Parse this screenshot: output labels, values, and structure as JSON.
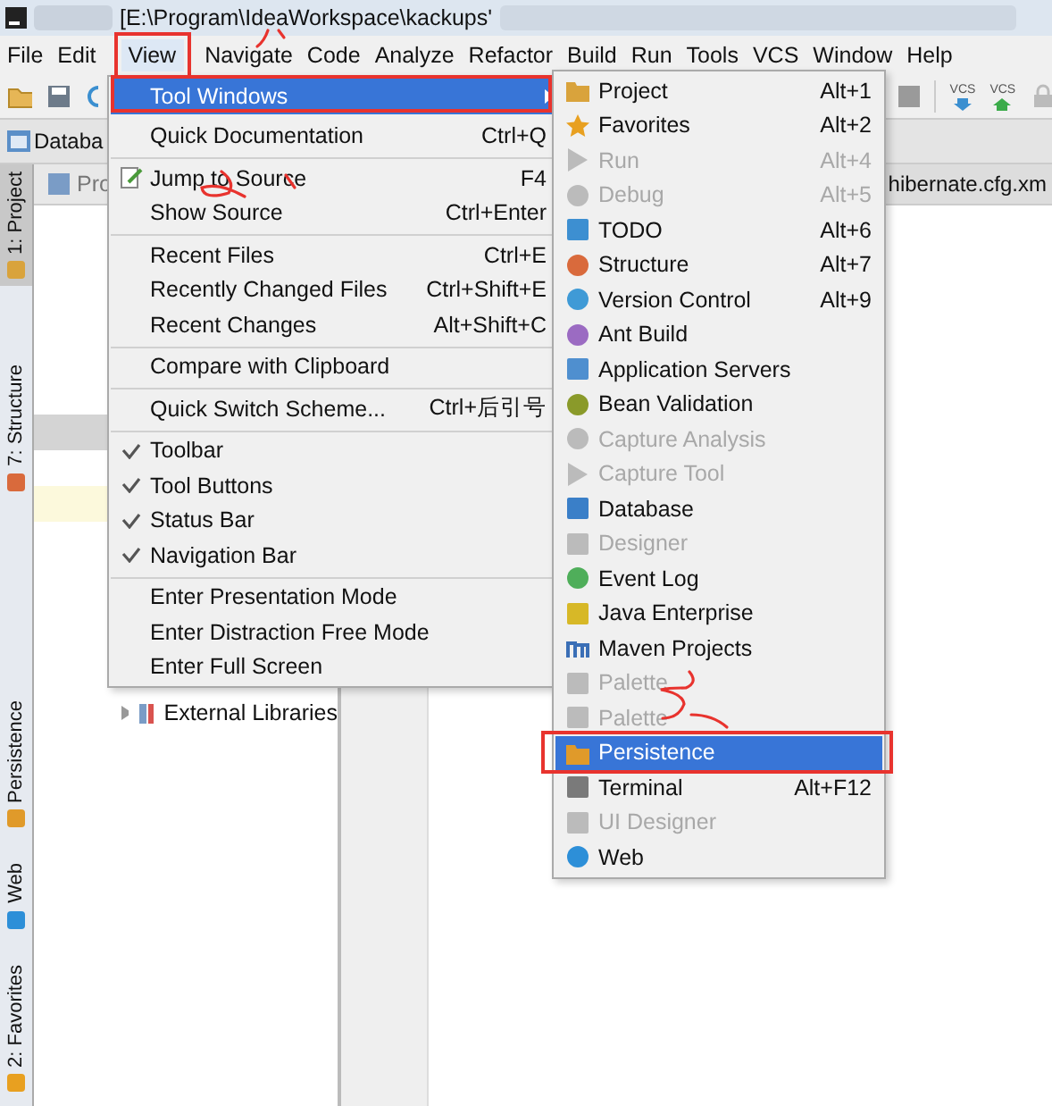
{
  "window": {
    "title": "[E:\\Program\\IdeaWorkspace\\kackups'"
  },
  "menubar": [
    {
      "label": "File",
      "selected": false
    },
    {
      "label": "Edit",
      "selected": false
    },
    {
      "label": "View",
      "selected": true
    },
    {
      "label": "Navigate",
      "selected": false
    },
    {
      "label": "Code",
      "selected": false
    },
    {
      "label": "Analyze",
      "selected": false
    },
    {
      "label": "Refactor",
      "selected": false
    },
    {
      "label": "Build",
      "selected": false
    },
    {
      "label": "Run",
      "selected": false
    },
    {
      "label": "Tools",
      "selected": false
    },
    {
      "label": "VCS",
      "selected": false
    },
    {
      "label": "Window",
      "selected": false
    },
    {
      "label": "Help",
      "selected": false
    }
  ],
  "toolbar": {
    "vcs_labels": [
      "VCS",
      "VCS"
    ]
  },
  "navigation_bar": {
    "label": "Databa"
  },
  "project_panel": {
    "tab": "Pro",
    "rows": [
      {
        "label": "External Libraries"
      }
    ]
  },
  "editor_tabs": [
    {
      "label": "hibernate.cfg.xm"
    }
  ],
  "left_stripe": {
    "top": [
      {
        "label": "1: Project",
        "selected": true,
        "kind": "project"
      },
      {
        "label": "7: Structure",
        "selected": false,
        "kind": "structure"
      }
    ],
    "bottom": [
      {
        "label": "Persistence",
        "selected": false,
        "kind": "persistence"
      },
      {
        "label": "Web",
        "selected": false,
        "kind": "web"
      },
      {
        "label": "2: Favorites",
        "selected": false,
        "kind": "favorites"
      }
    ]
  },
  "view_menu": {
    "items": [
      {
        "kind": "submenu",
        "label": "Tool Windows",
        "selected": true,
        "checked": false
      },
      {
        "kind": "item",
        "label": "Quick Documentation",
        "shortcut": "Ctrl+Q",
        "selected": false,
        "checked": false
      },
      {
        "kind": "separator"
      },
      {
        "kind": "item",
        "label": "Jump to Source",
        "shortcut": "F4",
        "selected": false,
        "checked": false,
        "icon": true
      },
      {
        "kind": "item",
        "label": "Show Source",
        "shortcut": "Ctrl+Enter",
        "selected": false,
        "checked": false
      },
      {
        "kind": "separator"
      },
      {
        "kind": "item",
        "label": "Recent Files",
        "shortcut": "Ctrl+E",
        "selected": false,
        "checked": false
      },
      {
        "kind": "item",
        "label": "Recently Changed Files",
        "shortcut": "Ctrl+Shift+E",
        "selected": false,
        "checked": false
      },
      {
        "kind": "item",
        "label": "Recent Changes",
        "shortcut": "Alt+Shift+C",
        "selected": false,
        "checked": false
      },
      {
        "kind": "separator"
      },
      {
        "kind": "item",
        "label": "Compare with Clipboard",
        "selected": false,
        "checked": false
      },
      {
        "kind": "separator"
      },
      {
        "kind": "item",
        "label": "Quick Switch Scheme...",
        "shortcut": "Ctrl+后引号",
        "selected": false,
        "checked": false
      },
      {
        "kind": "separator"
      },
      {
        "kind": "item",
        "label": "Toolbar",
        "selected": false,
        "checked": true
      },
      {
        "kind": "item",
        "label": "Tool Buttons",
        "selected": false,
        "checked": true
      },
      {
        "kind": "item",
        "label": "Status Bar",
        "selected": false,
        "checked": true
      },
      {
        "kind": "item",
        "label": "Navigation Bar",
        "selected": false,
        "checked": true
      },
      {
        "kind": "separator"
      },
      {
        "kind": "item",
        "label": "Enter Presentation Mode",
        "selected": false,
        "checked": false
      },
      {
        "kind": "item",
        "label": "Enter Distraction Free Mode",
        "selected": false,
        "checked": false
      },
      {
        "kind": "item",
        "label": "Enter Full Screen",
        "selected": false,
        "checked": false
      }
    ]
  },
  "tool_windows_menu": {
    "items": [
      {
        "kind": "project",
        "label": "Project",
        "shortcut": "Alt+1",
        "disabled": false,
        "selected": false
      },
      {
        "kind": "favorites",
        "label": "Favorites",
        "shortcut": "Alt+2",
        "disabled": false,
        "selected": false
      },
      {
        "kind": "run",
        "label": "Run",
        "shortcut": "Alt+4",
        "disabled": true,
        "selected": false
      },
      {
        "kind": "debug",
        "label": "Debug",
        "shortcut": "Alt+5",
        "disabled": true,
        "selected": false
      },
      {
        "kind": "todo",
        "label": "TODO",
        "shortcut": "Alt+6",
        "disabled": false,
        "selected": false
      },
      {
        "kind": "structure",
        "label": "Structure",
        "shortcut": "Alt+7",
        "disabled": false,
        "selected": false
      },
      {
        "kind": "vcs",
        "label": "Version Control",
        "shortcut": "Alt+9",
        "disabled": false,
        "selected": false
      },
      {
        "kind": "ant",
        "label": "Ant Build",
        "disabled": false,
        "selected": false
      },
      {
        "kind": "servers",
        "label": "Application Servers",
        "disabled": false,
        "selected": false
      },
      {
        "kind": "bean",
        "label": "Bean Validation",
        "disabled": false,
        "selected": false
      },
      {
        "kind": "capture",
        "label": "Capture Analysis",
        "disabled": true,
        "selected": false
      },
      {
        "kind": "run",
        "label": "Capture Tool",
        "disabled": true,
        "selected": false
      },
      {
        "kind": "database",
        "label": "Database",
        "disabled": false,
        "selected": false
      },
      {
        "kind": "designer",
        "label": "Designer",
        "disabled": true,
        "selected": false
      },
      {
        "kind": "eventlog",
        "label": "Event Log",
        "disabled": false,
        "selected": false
      },
      {
        "kind": "javaee",
        "label": "Java Enterprise",
        "disabled": false,
        "selected": false
      },
      {
        "kind": "maven",
        "label": "Maven Projects",
        "disabled": false,
        "selected": false
      },
      {
        "kind": "palette",
        "label": "Palette",
        "disabled": true,
        "selected": false
      },
      {
        "kind": "palette",
        "label": "Palette",
        "disabled": true,
        "selected": false
      },
      {
        "kind": "persistence",
        "label": "Persistence",
        "disabled": false,
        "selected": true
      },
      {
        "kind": "terminal",
        "label": "Terminal",
        "shortcut": "Alt+F12",
        "disabled": false,
        "selected": false
      },
      {
        "kind": "designer",
        "label": "UI Designer",
        "disabled": true,
        "selected": false
      },
      {
        "kind": "web",
        "label": "Web",
        "disabled": false,
        "selected": false
      }
    ]
  }
}
